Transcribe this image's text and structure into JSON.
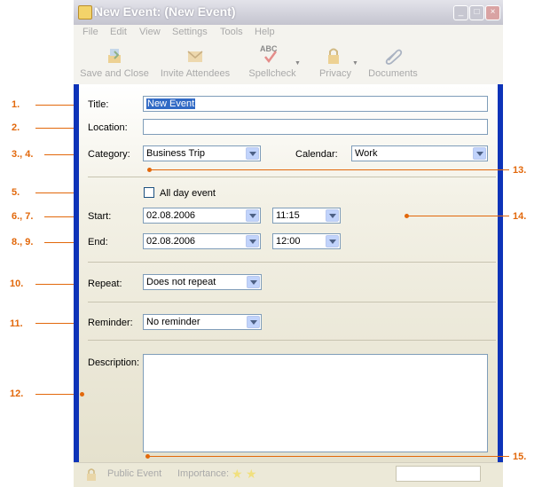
{
  "window": {
    "title": "New Event: (New Event)",
    "minimize_glyph": "_",
    "maximize_glyph": "□",
    "close_glyph": "×"
  },
  "menu": [
    "File",
    "Edit",
    "View",
    "Settings",
    "Tools",
    "Help"
  ],
  "toolbar": {
    "save_close": "Save and Close",
    "invite": "Invite Attendees",
    "spellcheck": "Spellcheck",
    "privacy": "Privacy",
    "documents": "Documents",
    "spellcheck_icon_text": "ABC"
  },
  "form": {
    "title_label": "Title:",
    "title_value": "New Event",
    "location_label": "Location:",
    "location_value": "",
    "category_label": "Category:",
    "category_value": "Business Trip",
    "calendar_label": "Calendar:",
    "calendar_value": "Work",
    "all_day_label": "All day event",
    "start_label": "Start:",
    "start_date": "02.08.2006",
    "start_time": "11:15",
    "end_label": "End:",
    "end_date": "02.08.2006",
    "end_time": "12:00",
    "repeat_label": "Repeat:",
    "repeat_value": "Does not repeat",
    "reminder_label": "Reminder:",
    "reminder_value": "No reminder",
    "description_label": "Description:",
    "description_value": ""
  },
  "statusbar": {
    "public_event": "Public Event",
    "importance_label": "Importance:"
  },
  "annotations": {
    "n1": "1.",
    "n2": "2.",
    "n3": "3., 4.",
    "n5": "5.",
    "n6": "6., 7.",
    "n8": "8., 9.",
    "n10": "10.",
    "n11": "11.",
    "n12": "12.",
    "n13": "13.",
    "n14": "14.",
    "n15": "15."
  },
  "colors": {
    "annotation": "#e2680b",
    "window_border": "#0d33b8",
    "selection": "#316ac5"
  }
}
